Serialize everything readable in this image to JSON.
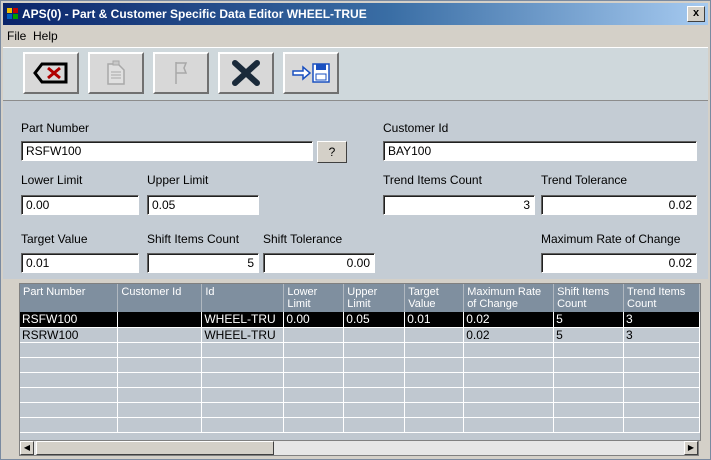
{
  "window": {
    "title": "APS(0) - Part & Customer Specific Data Editor WHEEL-TRUE",
    "close_label": "x"
  },
  "menu": {
    "file": "File",
    "help": "Help"
  },
  "toolbar": {
    "buttons": [
      {
        "name": "delete",
        "icon": "backspace-icon",
        "enabled": true
      },
      {
        "name": "document",
        "icon": "document-icon",
        "enabled": false
      },
      {
        "name": "flag",
        "icon": "flag-icon",
        "enabled": false
      },
      {
        "name": "cancel",
        "icon": "x-icon",
        "enabled": true
      },
      {
        "name": "save",
        "icon": "arrow-save-icon",
        "enabled": true
      }
    ]
  },
  "form": {
    "part_number": {
      "label": "Part Number",
      "value": "RSFW100"
    },
    "lookup_button": "?",
    "customer_id": {
      "label": "Customer Id",
      "value": "BAY100"
    },
    "lower_limit": {
      "label": "Lower Limit",
      "value": "0.00"
    },
    "upper_limit": {
      "label": "Upper Limit",
      "value": "0.05"
    },
    "trend_items_count": {
      "label": "Trend Items Count",
      "value": "3"
    },
    "trend_tolerance": {
      "label": "Trend Tolerance",
      "value": "0.02"
    },
    "target_value": {
      "label": "Target Value",
      "value": "0.01"
    },
    "shift_items_count": {
      "label": "Shift Items Count",
      "value": "5"
    },
    "shift_tolerance": {
      "label": "Shift Tolerance",
      "value": "0.00"
    },
    "max_rate_change": {
      "label": "Maximum Rate of Change",
      "value": "0.02"
    }
  },
  "grid": {
    "columns": [
      {
        "l1": "Part Number",
        "l2": ""
      },
      {
        "l1": "Customer Id",
        "l2": ""
      },
      {
        "l1": "Id",
        "l2": ""
      },
      {
        "l1": "Lower",
        "l2": "Limit"
      },
      {
        "l1": "Upper",
        "l2": "Limit"
      },
      {
        "l1": "Target",
        "l2": "Value"
      },
      {
        "l1": "Maximum Rate",
        "l2": "of Change"
      },
      {
        "l1": "Shift Items",
        "l2": "Count"
      },
      {
        "l1": "Trend Items",
        "l2": "Count"
      }
    ],
    "rows": [
      [
        "RSFW100",
        "",
        "WHEEL-TRU",
        "0.00",
        "0.05",
        "0.01",
        "0.02",
        "5",
        "3"
      ],
      [
        "RSRW100",
        "",
        "WHEEL-TRU",
        "",
        "",
        "",
        "0.02",
        "5",
        "3"
      ],
      [
        "",
        "",
        "",
        "",
        "",
        "",
        "",
        "",
        ""
      ],
      [
        "",
        "",
        "",
        "",
        "",
        "",
        "",
        "",
        ""
      ],
      [
        "",
        "",
        "",
        "",
        "",
        "",
        "",
        "",
        ""
      ],
      [
        "",
        "",
        "",
        "",
        "",
        "",
        "",
        "",
        ""
      ],
      [
        "",
        "",
        "",
        "",
        "",
        "",
        "",
        "",
        ""
      ],
      [
        "",
        "",
        "",
        "",
        "",
        "",
        "",
        "",
        ""
      ]
    ],
    "selected_row": 0
  },
  "colors": {
    "title_start": "#0a246a",
    "title_end": "#a6caf0",
    "header_bg": "#7f8f9f",
    "selected_bg": "#000000"
  }
}
